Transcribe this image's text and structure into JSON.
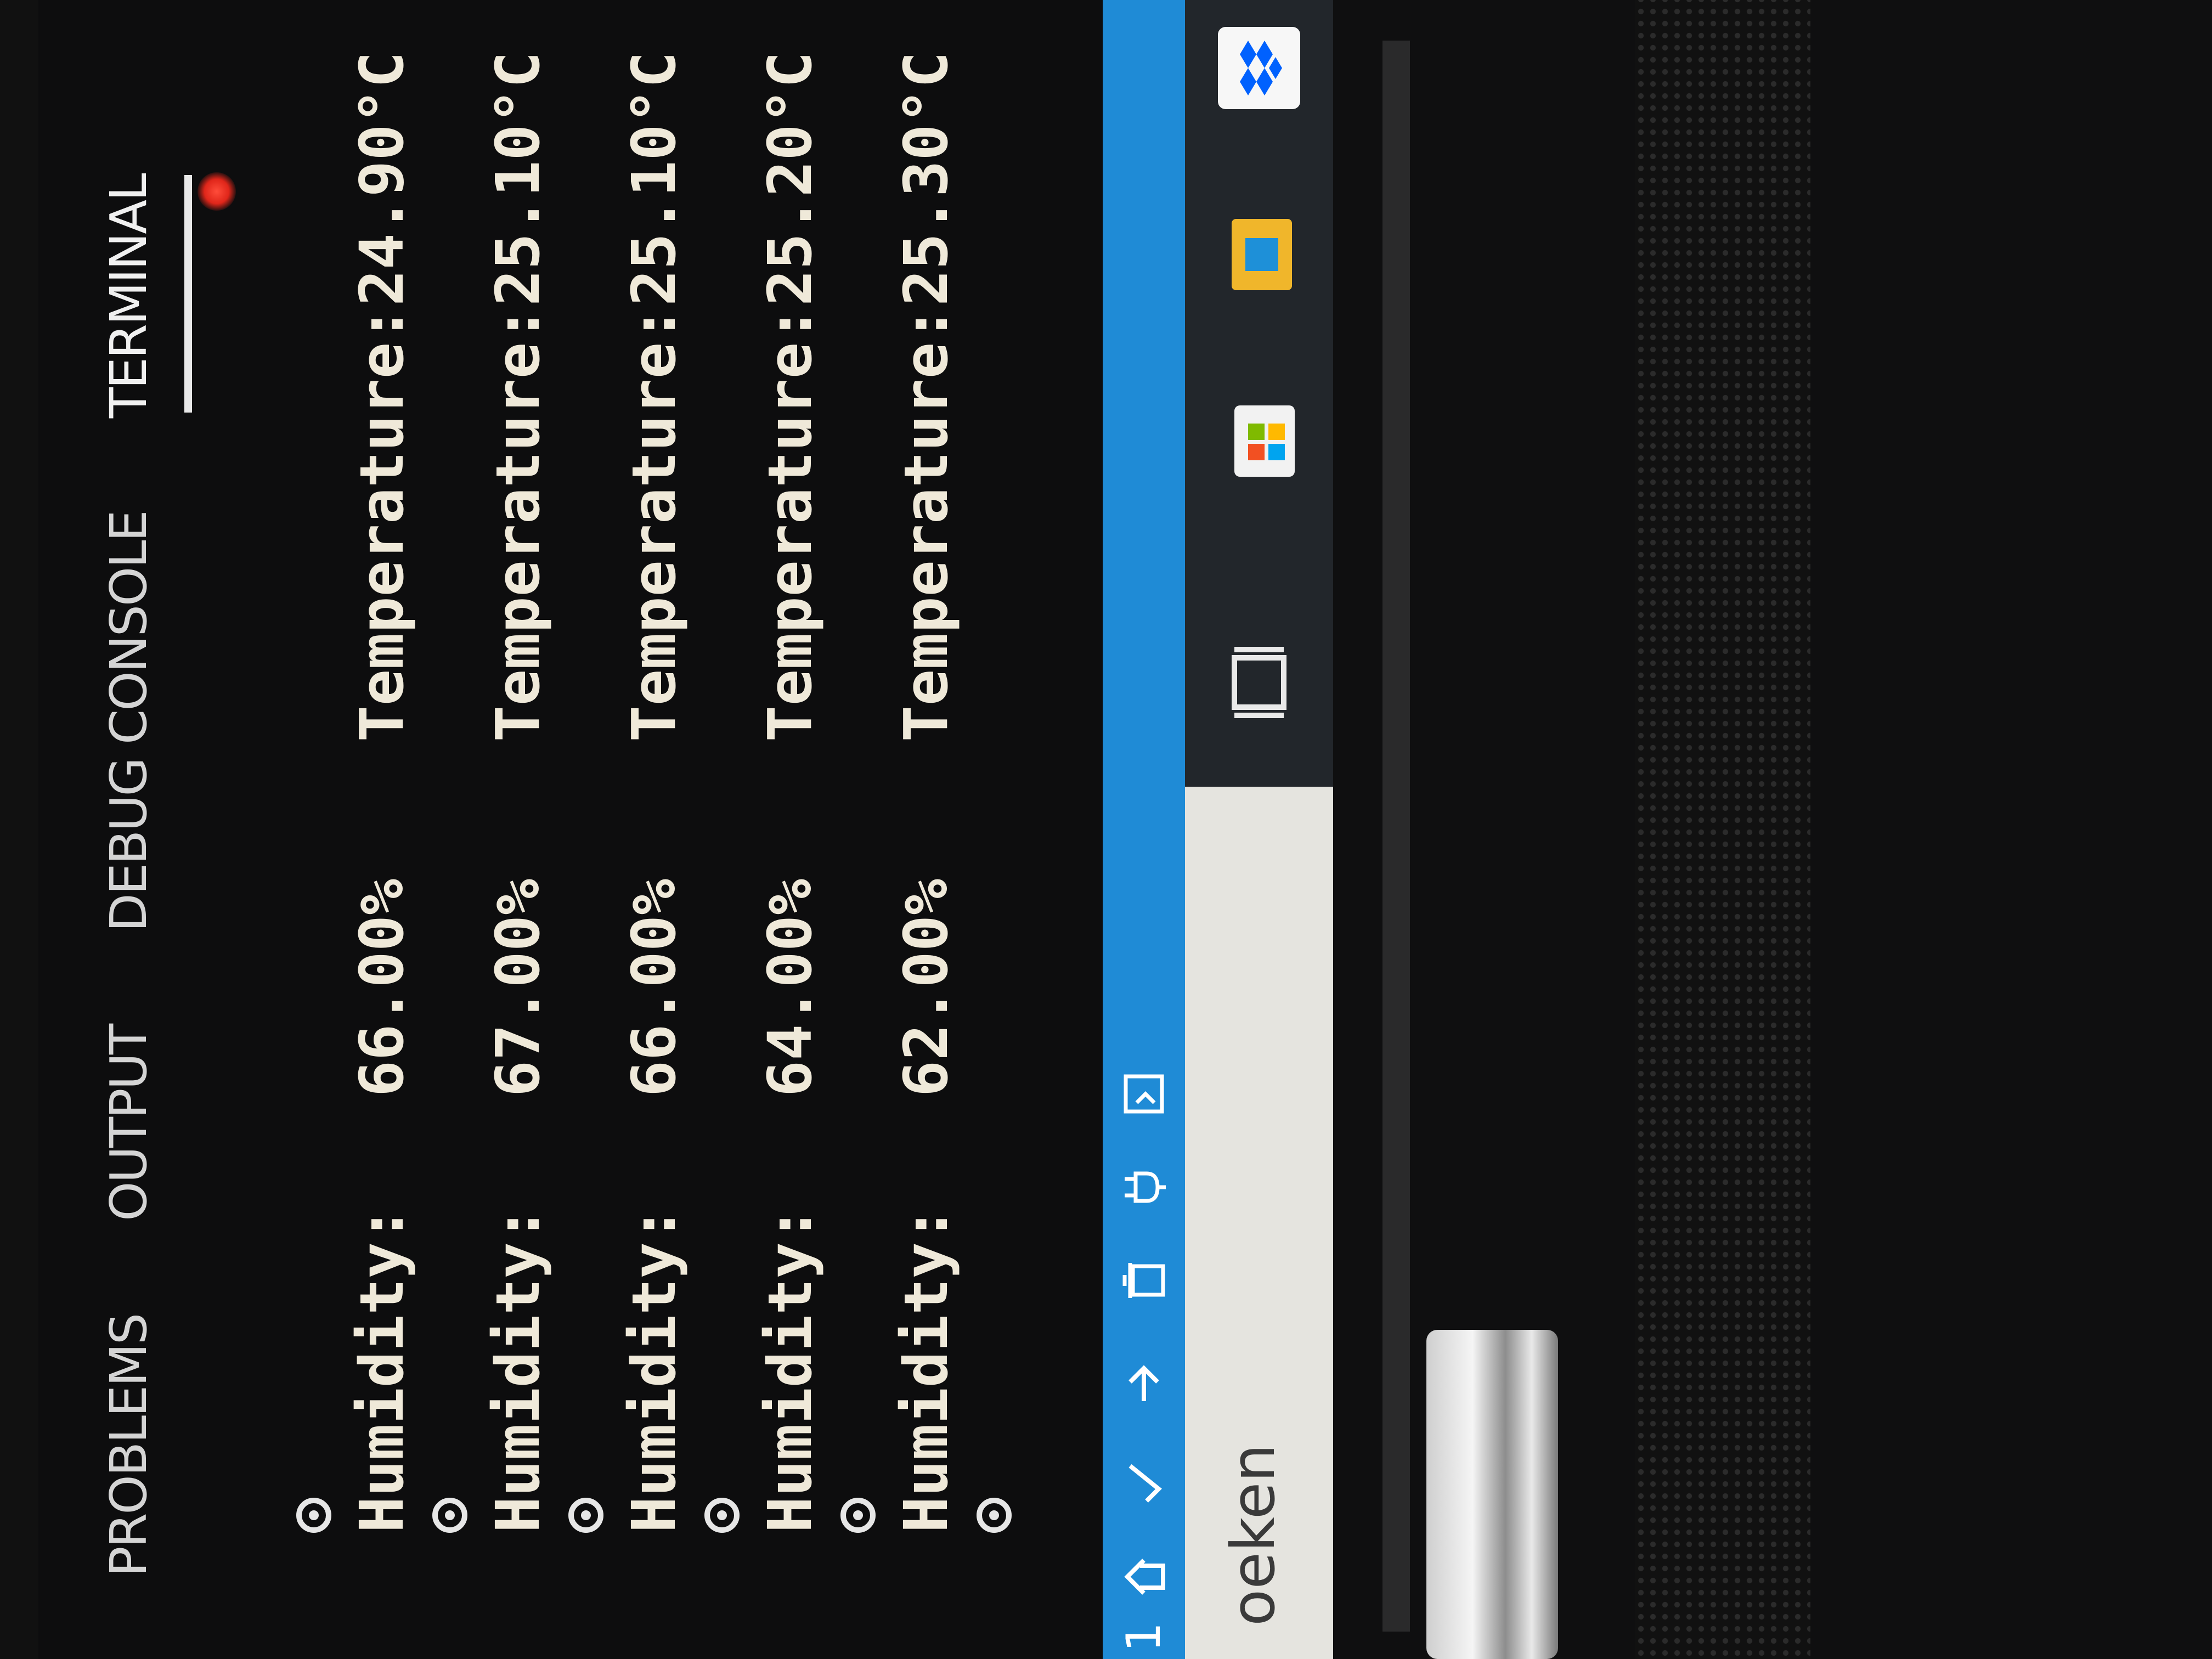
{
  "panel": {
    "tabs": [
      {
        "label": "PROBLEMS",
        "active": false
      },
      {
        "label": "OUTPUT",
        "active": false
      },
      {
        "label": "DEBUG CONSOLE",
        "active": false
      },
      {
        "label": "TERMINAL",
        "active": true
      }
    ]
  },
  "terminal": {
    "lines": [
      {
        "humidity_label": "Humidity:",
        "humidity": "66.00%",
        "temperature_label": "Temperature:",
        "temperature": "24.90°C"
      },
      {
        "humidity_label": "Humidity:",
        "humidity": "67.00%",
        "temperature_label": "Temperature:",
        "temperature": "25.10°C"
      },
      {
        "humidity_label": "Humidity:",
        "humidity": "66.00%",
        "temperature_label": "Temperature:",
        "temperature": "25.10°C"
      },
      {
        "humidity_label": "Humidity:",
        "humidity": "64.00%",
        "temperature_label": "Temperature:",
        "temperature": "25.20°C"
      },
      {
        "humidity_label": "Humidity:",
        "humidity": "62.00%",
        "temperature_label": "Temperature:",
        "temperature": "25.30°C"
      }
    ]
  },
  "status_bar": {
    "color": "#1f8bd6",
    "left_text": "1",
    "icons": [
      "home-icon",
      "check-icon",
      "upload-arrow-icon",
      "trash-icon",
      "plug-icon",
      "serial-monitor-icon"
    ]
  },
  "taskbar": {
    "search_placeholder": "oeken",
    "icons": [
      "task-view-icon",
      "store-icon",
      "file-explorer-icon",
      "dropbox-icon"
    ]
  },
  "colors": {
    "terminal_text": "#efe9d9",
    "background": "#0d0d0e",
    "status_bar": "#1f8bd6",
    "taskbar": "#22262b"
  }
}
